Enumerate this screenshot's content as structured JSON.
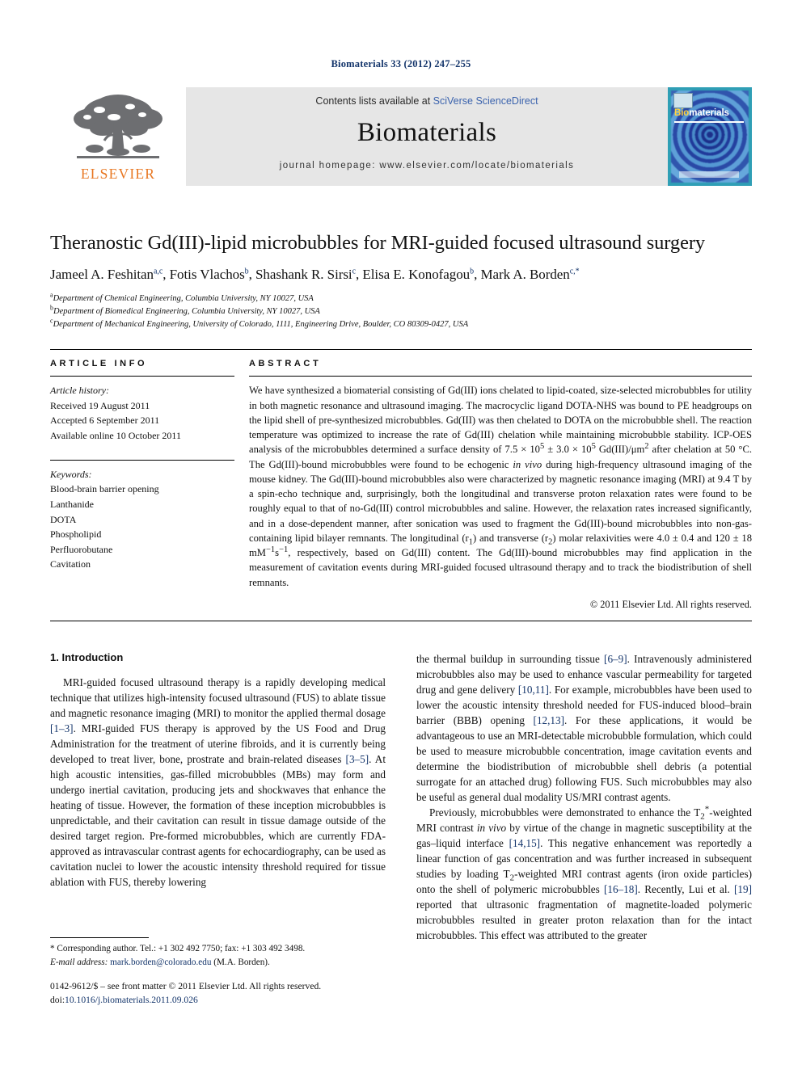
{
  "running_head": "Biomaterials 33 (2012) 247–255",
  "masthead": {
    "publisher": "ELSEVIER",
    "contents_prefix": "Contents lists available at ",
    "contents_link": "SciVerse ScienceDirect",
    "journal_title": "Biomaterials",
    "homepage": "journal homepage: www.elsevier.com/locate/biomaterials",
    "cover": {
      "title_bio": "Bio",
      "title_materials": "materials"
    }
  },
  "article": {
    "title": "Theranostic Gd(III)-lipid microbubbles for MRI-guided focused ultrasound surgery",
    "authors": [
      {
        "name": "Jameel A. Feshitan",
        "marks": "a,c"
      },
      {
        "name": "Fotis Vlachos",
        "marks": "b"
      },
      {
        "name": "Shashank R. Sirsi",
        "marks": "c"
      },
      {
        "name": "Elisa E. Konofagou",
        "marks": "b"
      },
      {
        "name": "Mark A. Borden",
        "marks": "c,*"
      }
    ],
    "affiliations": [
      {
        "mark": "a",
        "text": "Department of Chemical Engineering, Columbia University, NY 10027, USA"
      },
      {
        "mark": "b",
        "text": "Department of Biomedical Engineering, Columbia University, NY 10027, USA"
      },
      {
        "mark": "c",
        "text": "Department of Mechanical Engineering, University of Colorado, 1111, Engineering Drive, Boulder, CO 80309-0427, USA"
      }
    ]
  },
  "article_info": {
    "heading": "ARTICLE INFO",
    "history_label": "Article history:",
    "history": [
      "Received 19 August 2011",
      "Accepted 6 September 2011",
      "Available online 10 October 2011"
    ],
    "keywords_label": "Keywords:",
    "keywords": [
      "Blood-brain barrier opening",
      "Lanthanide",
      "DOTA",
      "Phospholipid",
      "Perfluorobutane",
      "Cavitation"
    ]
  },
  "abstract": {
    "heading": "ABSTRACT",
    "text_part1": "We have synthesized a biomaterial consisting of Gd(III) ions chelated to lipid-coated, size-selected microbubbles for utility in both magnetic resonance and ultrasound imaging. The macrocyclic ligand DOTA-NHS was bound to PE headgroups on the lipid shell of pre-synthesized microbubbles. Gd(III) was then chelated to DOTA on the microbubble shell. The reaction temperature was optimized to increase the rate of Gd(III) chelation while maintaining microbubble stability. ICP-OES analysis of the microbubbles determined a surface density of 7.5 × 10",
    "sup1": "5",
    "text_part2": " ± 3.0 × 10",
    "sup2": "5",
    "text_part3": " Gd(III)/μm",
    "sup3": "2",
    "text_part4": " after chelation at 50 °C. The Gd(III)-bound microbubbles were found to be echogenic ",
    "italic1": "in vivo",
    "text_part5": " during high-frequency ultrasound imaging of the mouse kidney. The Gd(III)-bound microbubbles also were characterized by magnetic resonance imaging (MRI) at 9.4 T by a spin-echo technique and, surprisingly, both the longitudinal and transverse proton relaxation rates were found to be roughly equal to that of no-Gd(III) control microbubbles and saline. However, the relaxation rates increased significantly, and in a dose-dependent manner, after sonication was used to fragment the Gd(III)-bound microbubbles into non-gas-containing lipid bilayer remnants. The longitudinal (r",
    "sub1": "1",
    "text_part6": ") and transverse (r",
    "sub2": "2",
    "text_part7": ") molar relaxivities were 4.0 ± 0.4 and 120 ± 18 mM",
    "sup4": "−1",
    "text_part8": "s",
    "sup5": "−1",
    "text_part9": ", respectively, based on Gd(III) content. The Gd(III)-bound microbubbles may find application in the measurement of cavitation events during MRI-guided focused ultrasound therapy and to track the biodistribution of shell remnants.",
    "copyright": "© 2011 Elsevier Ltd. All rights reserved."
  },
  "body": {
    "section_heading": "1. Introduction",
    "left_col": {
      "p1_a": "MRI-guided focused ultrasound therapy is a rapidly developing medical technique that utilizes high-intensity focused ultrasound (FUS) to ablate tissue and magnetic resonance imaging (MRI) to monitor the applied thermal dosage ",
      "ref1": "[1–3]",
      "p1_b": ". MRI-guided FUS therapy is approved by the US Food and Drug Administration for the treatment of uterine fibroids, and it is currently being developed to treat liver, bone, prostrate and brain-related diseases ",
      "ref2": "[3–5]",
      "p1_c": ". At high acoustic intensities, gas-filled microbubbles (MBs) may form and undergo inertial cavitation, producing jets and shockwaves that enhance the heating of tissue. However, the formation of these inception microbubbles is unpredictable, and their cavitation can result in tissue damage outside of the desired target region. Pre-formed microbubbles, which are currently FDA-approved as intravascular contrast agents for echocardiography, can be used as cavitation nuclei to lower the acoustic intensity threshold required for tissue ablation with FUS, thereby lowering"
    },
    "right_col": {
      "p1_cont_a": "the thermal buildup in surrounding tissue ",
      "ref3": "[6–9]",
      "p1_cont_b": ". Intravenously administered microbubbles also may be used to enhance vascular permeability for targeted drug and gene delivery ",
      "ref4": "[10,11]",
      "p1_cont_c": ". For example, microbubbles have been used to lower the acoustic intensity threshold needed for FUS-induced blood–brain barrier (BBB) opening ",
      "ref5": "[12,13]",
      "p1_cont_d": ". For these applications, it would be advantageous to use an MRI-detectable microbubble formulation, which could be used to measure microbubble concentration, image cavitation events and determine the biodistribution of microbubble shell debris (a potential surrogate for an attached drug) following FUS. Such microbubbles may also be useful as general dual modality US/MRI contrast agents.",
      "p2_a": "Previously, microbubbles were demonstrated to enhance the T",
      "p2_sub": "2",
      "p2_sup": "*",
      "p2_b": "-weighted MRI contrast ",
      "p2_italic": "in vivo",
      "p2_c": " by virtue of the change in magnetic susceptibility at the gas–liquid interface ",
      "ref6": "[14,15]",
      "p2_d": ". This negative enhancement was reportedly a linear function of gas concentration and was further increased in subsequent studies by loading T",
      "p2_sub2": "2",
      "p2_e": "-weighted MRI contrast agents (iron oxide particles) onto the shell of polymeric microbubbles ",
      "ref7": "[16–18]",
      "p2_f": ". Recently, Lui et al. ",
      "ref8": "[19]",
      "p2_g": " reported that ultrasonic fragmentation of magnetite-loaded polymeric microbubbles resulted in greater proton relaxation than for the intact microbubbles. This effect was attributed to the greater"
    }
  },
  "footnote": {
    "corresponding": "* Corresponding author. Tel.: +1 302 492 7750; fax: +1 303 492 3498.",
    "email_label": "E-mail address:",
    "email": "mark.borden@colorado.edu",
    "email_suffix": "(M.A. Borden)."
  },
  "imprint": {
    "line1": "0142-9612/$ – see front matter © 2011 Elsevier Ltd. All rights reserved.",
    "doi_label": "doi:",
    "doi": "10.1016/j.biomaterials.2011.09.026"
  },
  "colors": {
    "link": "#3b63ad",
    "reference": "#14356b",
    "elsevier_orange": "#E87722",
    "masthead_bg": "#e6e6e6"
  }
}
